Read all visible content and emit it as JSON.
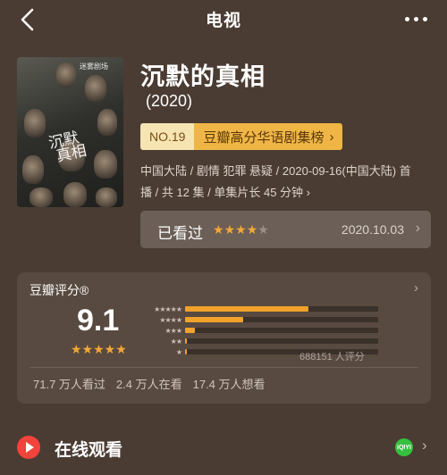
{
  "header": {
    "title": "电视"
  },
  "poster": {
    "logo_text": "迷雾剧场",
    "title_glyphs": "沉默\n真相"
  },
  "show": {
    "name": "沉默的真相",
    "year": "(2020)"
  },
  "ranking": {
    "number": "NO.19",
    "list_name": "豆瓣高分华语剧集榜",
    "chevron": "›"
  },
  "meta": {
    "line1": "中国大陆 / 剧情 犯罪 悬疑 / 2020-09-16(中国大陆) 首",
    "line2": "播 / 共 12 集 / 单集片长 45 分钟 ›"
  },
  "watched": {
    "label": "已看过",
    "stars": "★★★★★",
    "rating": 4,
    "date": "2020.10.03",
    "chevron": "›",
    "colors": {
      "on": "#f2a838",
      "off": "#9a8e86"
    }
  },
  "douban": {
    "header": "豆瓣评分®",
    "chevron": "›",
    "score": "9.1",
    "stars": "★★★★★",
    "star_labels": [
      "★★★★★",
      "★★★★",
      "★★★",
      "★★",
      "★"
    ],
    "distribution": [
      0.64,
      0.3,
      0.05,
      0.01,
      0.01
    ],
    "votes": "688151 人评分",
    "stats": [
      "71.7 万人看过",
      "2.4 万人在看",
      "17.4 万人想看"
    ]
  },
  "online": {
    "label": "在线观看",
    "provider_badge": "iQIYI",
    "chevron": "›"
  },
  "colors": {
    "background": "#4a3c33",
    "accent": "#f0a22a",
    "rank_badge": "#efb646"
  }
}
